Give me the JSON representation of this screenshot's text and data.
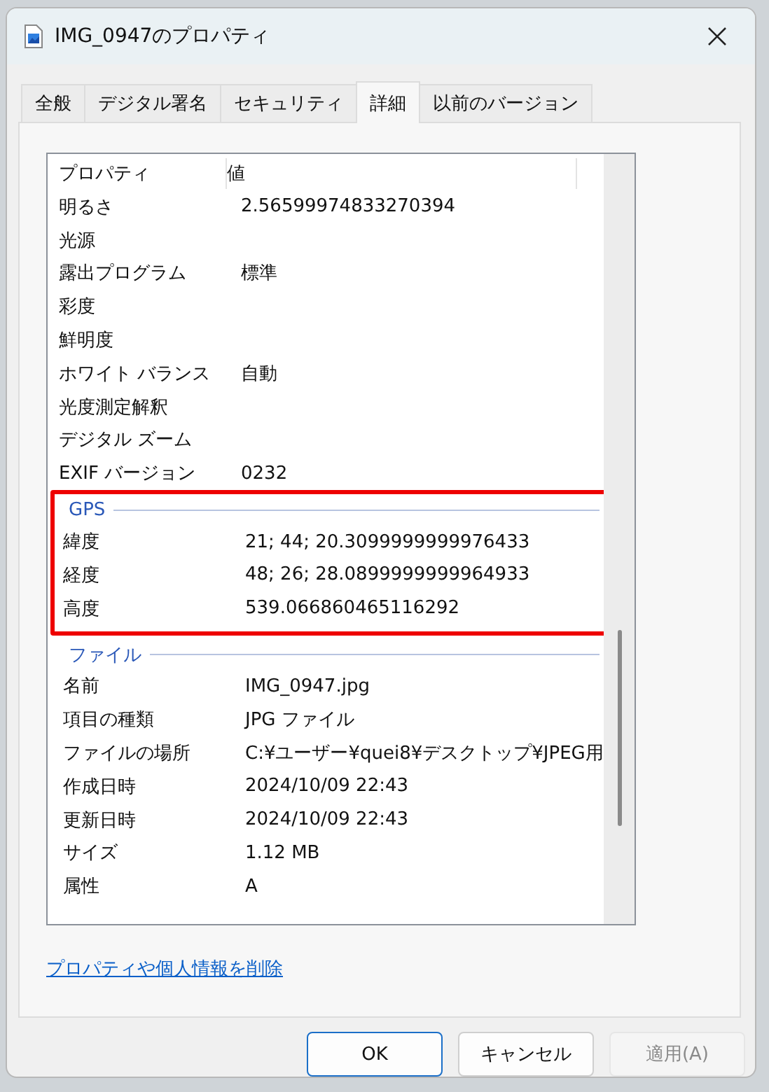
{
  "window": {
    "title": "IMG_0947のプロパティ"
  },
  "tabs": [
    {
      "label": "全般",
      "selected": false
    },
    {
      "label": "デジタル署名",
      "selected": false
    },
    {
      "label": "セキュリティ",
      "selected": false
    },
    {
      "label": "詳細",
      "selected": true
    },
    {
      "label": "以前のバージョン",
      "selected": false
    }
  ],
  "list": {
    "columns": [
      "プロパティ",
      "値"
    ],
    "sections": [
      {
        "kind": "plain",
        "rows": [
          [
            "明るさ",
            "2.56599974833270394"
          ],
          [
            "光源",
            ""
          ],
          [
            "露出プログラム",
            "標準"
          ],
          [
            "彩度",
            ""
          ],
          [
            "鮮明度",
            ""
          ],
          [
            "ホワイト バランス",
            "自動"
          ],
          [
            "光度測定解釈",
            ""
          ],
          [
            "デジタル ズーム",
            ""
          ],
          [
            "EXIF バージョン",
            "0232"
          ]
        ]
      },
      {
        "kind": "group",
        "title": "GPS",
        "highlighted": true,
        "rows": [
          [
            "緯度",
            "21; 44; 20.3099999999976433"
          ],
          [
            "経度",
            "48; 26; 28.0899999999964933"
          ],
          [
            "高度",
            "539.066860465116292"
          ]
        ]
      },
      {
        "kind": "group",
        "title": "ファイル",
        "highlighted": false,
        "rows": [
          [
            "名前",
            "IMG_0947.jpg"
          ],
          [
            "項目の種類",
            "JPG ファイル"
          ],
          [
            "ファイルの場所",
            "C:¥ユーザー¥quei8¥デスクトップ¥JPEG用"
          ],
          [
            "作成日時",
            "2024/10/09 22:43"
          ],
          [
            "更新日時",
            "2024/10/09 22:43"
          ],
          [
            "サイズ",
            "1.12 MB"
          ],
          [
            "属性",
            "A"
          ]
        ]
      }
    ]
  },
  "link": "プロパティや個人情報を削除",
  "buttons": [
    {
      "label": "OK",
      "default": true,
      "disabled": false
    },
    {
      "label": "キャンセル",
      "default": false,
      "disabled": false
    },
    {
      "label": "適用(A)",
      "default": false,
      "disabled": true
    }
  ]
}
